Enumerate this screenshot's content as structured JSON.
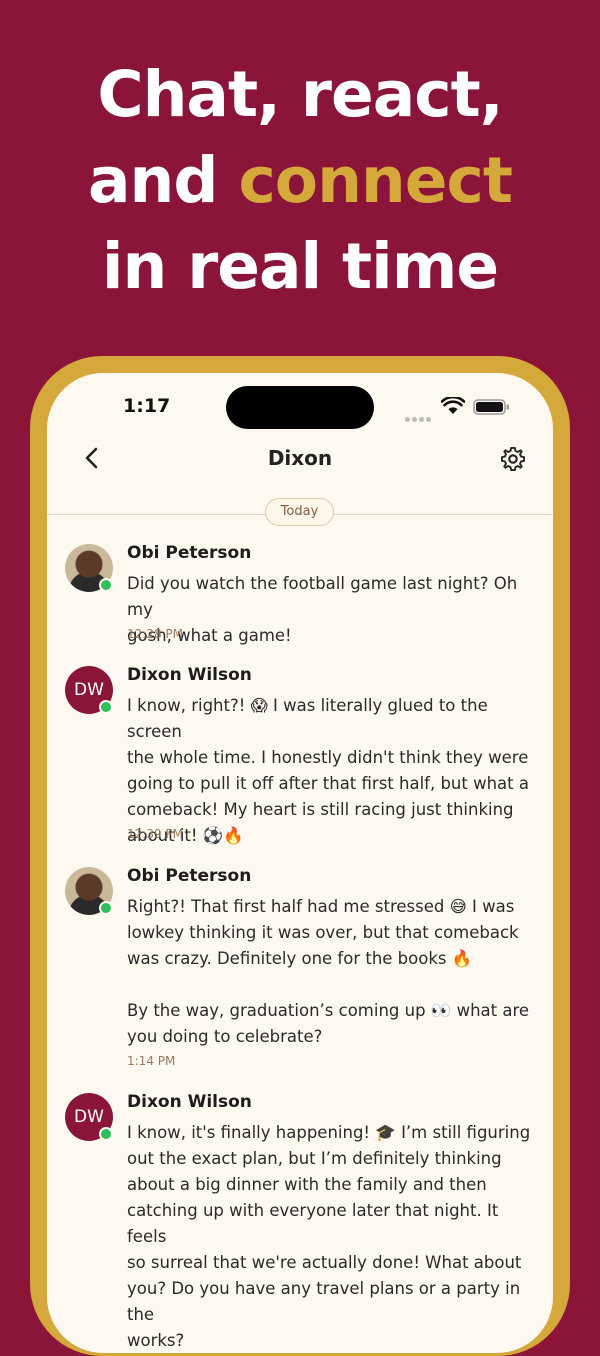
{
  "headline": {
    "line1": "Chat, react,",
    "line2_prefix": "and ",
    "line2_accent": "connect",
    "line3": "in real time"
  },
  "colors": {
    "background": "#8b1538",
    "accent": "#d4a83a",
    "online": "#2fbf5a"
  },
  "status_bar": {
    "time": "1:17",
    "icons": [
      "cellular-signal-icon",
      "wifi-icon",
      "battery-icon"
    ]
  },
  "nav": {
    "title": "Dixon",
    "back_icon": "chevron-left-icon",
    "settings_icon": "gear-icon"
  },
  "date_divider": "Today",
  "messages": [
    {
      "sender": "Obi Peterson",
      "avatar": "photo",
      "text": "Did you watch the football game last night? Oh my\ngosh, what a game!",
      "time": "12:28 PM"
    },
    {
      "sender": "Dixon Wilson",
      "avatar": "DW",
      "text": "I know, right?! 😱 I was literally glued to the screen\nthe whole time. I honestly didn't think they were\ngoing to pull it off after that first half, but what a\ncomeback! My heart is still racing just thinking\nabout it! ⚽🔥",
      "time": "12:39 PM"
    },
    {
      "sender": "Obi Peterson",
      "avatar": "photo",
      "text": "Right?! That first half had me stressed 😅 I was\nlowkey thinking it was over, but that comeback\nwas crazy. Definitely one for the books 🔥\n\nBy the way, graduation’s coming up 👀 what are\nyou doing to celebrate?",
      "time": "1:14 PM"
    },
    {
      "sender": "Dixon Wilson",
      "avatar": "DW",
      "text": "I know, it's finally happening! 🎓 I’m still figuring\nout the exact plan, but I’m definitely thinking\nabout a big dinner with the family and then\ncatching up with everyone later that night. It feels\nso surreal that we're actually done! What about\nyou? Do you have any travel plans or a party in the\nworks?",
      "time": ""
    }
  ]
}
